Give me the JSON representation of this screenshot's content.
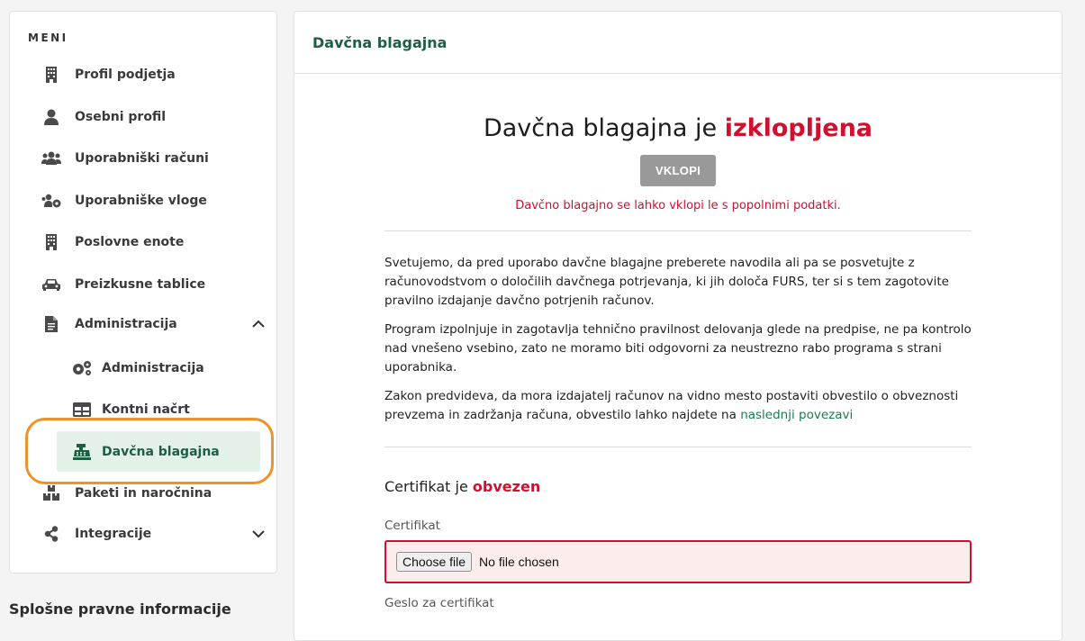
{
  "sidebar": {
    "menu_title": "MENI",
    "items": [
      {
        "label": "Profil podjetja",
        "icon": "building-icon"
      },
      {
        "label": "Osebni profil",
        "icon": "user-icon"
      },
      {
        "label": "Uporabniški računi",
        "icon": "users-icon"
      },
      {
        "label": "Uporabniške vloge",
        "icon": "users-gear-icon"
      },
      {
        "label": "Poslovne enote",
        "icon": "building-icon"
      },
      {
        "label": "Preizkusne tablice",
        "icon": "car-icon"
      },
      {
        "label": "Administracija",
        "icon": "document-icon",
        "expanded": true
      },
      {
        "label": "Paketi in naročnina",
        "icon": "boxes-icon"
      },
      {
        "label": "Integracije",
        "icon": "share-icon",
        "expanded": false
      }
    ],
    "sub_items": [
      {
        "label": "Administracija",
        "icon": "gears-icon"
      },
      {
        "label": "Kontni načrt",
        "icon": "table-icon"
      },
      {
        "label": "Davčna blagajna",
        "icon": "cash-register-icon",
        "active": true
      }
    ],
    "footer_title": "Splošne pravne informacije"
  },
  "main": {
    "header_title": "Davčna blagajna",
    "status_prefix": "Davčna blagajna je ",
    "status_value": "izklopljena",
    "enable_button": "VKLOPI",
    "warning": "Davčno blagajno se lahko vklopi le s popolnimi podatki.",
    "paragraph1": "Svetujemo, da pred uporabo davčne blagajne preberete navodila ali pa se posvetujte z računovodstvom o določilih davčnega potrjevanja, ki jih določa FURS, ter si s tem zagotovite pravilno izdajanje davčno potrjenih računov.",
    "paragraph2": "Program izpolnjuje in zagotavlja tehnično pravilnost delovanja glede na predpise, ne pa kontrolo nad vnešeno vsebino, zato ne moramo biti odgovorni za neustrezno rabo programa s strani uporabnika.",
    "paragraph3_text": "Zakon predvideva, da mora izdajatelj računov na vidno mesto postaviti obvestilo o obveznosti prevzema in zadržanja računa, obvestilo lahko najdete na ",
    "paragraph3_link": "naslednji povezavi",
    "cert_title_prefix": "Certifikat je ",
    "cert_title_value": "obvezen",
    "cert_label": "Certifikat",
    "file_button": "Choose file",
    "file_status": "No file chosen",
    "next_label": "Geslo za certifikat"
  },
  "colors": {
    "accent_green": "#1e5e43",
    "danger_red": "#d0102e",
    "highlight_orange": "#f0922a",
    "button_gray": "#999999"
  }
}
